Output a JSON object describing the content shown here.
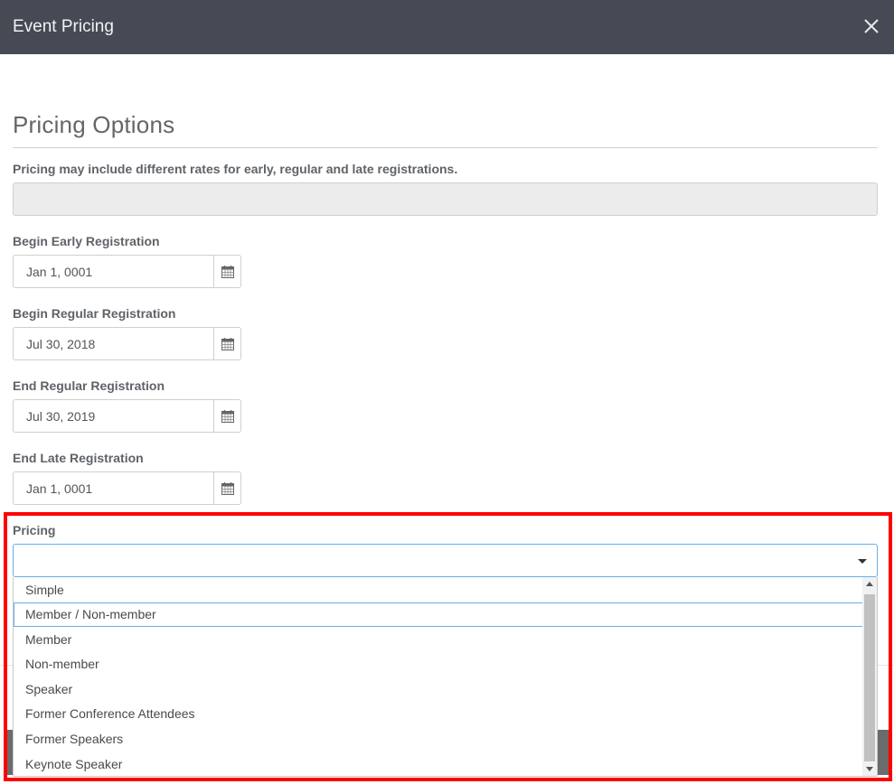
{
  "modal": {
    "title": "Event Pricing",
    "close_icon": "close-icon"
  },
  "section": {
    "title": "Pricing Options",
    "description": "Pricing may include different rates for early, regular and late registrations.",
    "description_field_value": ""
  },
  "fields": {
    "begin_early": {
      "label": "Begin Early Registration",
      "value": "Jan 1, 0001",
      "icon": "calendar-icon"
    },
    "begin_regular": {
      "label": "Begin Regular Registration",
      "value": "Jul 30, 2018",
      "icon": "calendar-icon"
    },
    "end_regular": {
      "label": "End Regular Registration",
      "value": "Jul 30, 2019",
      "icon": "calendar-icon"
    },
    "end_late": {
      "label": "End Late Registration",
      "value": "Jan 1, 0001",
      "icon": "calendar-icon"
    }
  },
  "pricing": {
    "label": "Pricing",
    "selected": "",
    "highlighted_option": "Member / Non-member",
    "options": [
      "Simple",
      "Member / Non-member",
      "Member",
      "Non-member",
      "Speaker",
      "Former Conference Attendees",
      "Former Speakers",
      "Keynote Speaker"
    ]
  },
  "colors": {
    "header_bg": "#464a55",
    "focus_border": "#66afe9",
    "annotation_red": "#ff0000"
  }
}
